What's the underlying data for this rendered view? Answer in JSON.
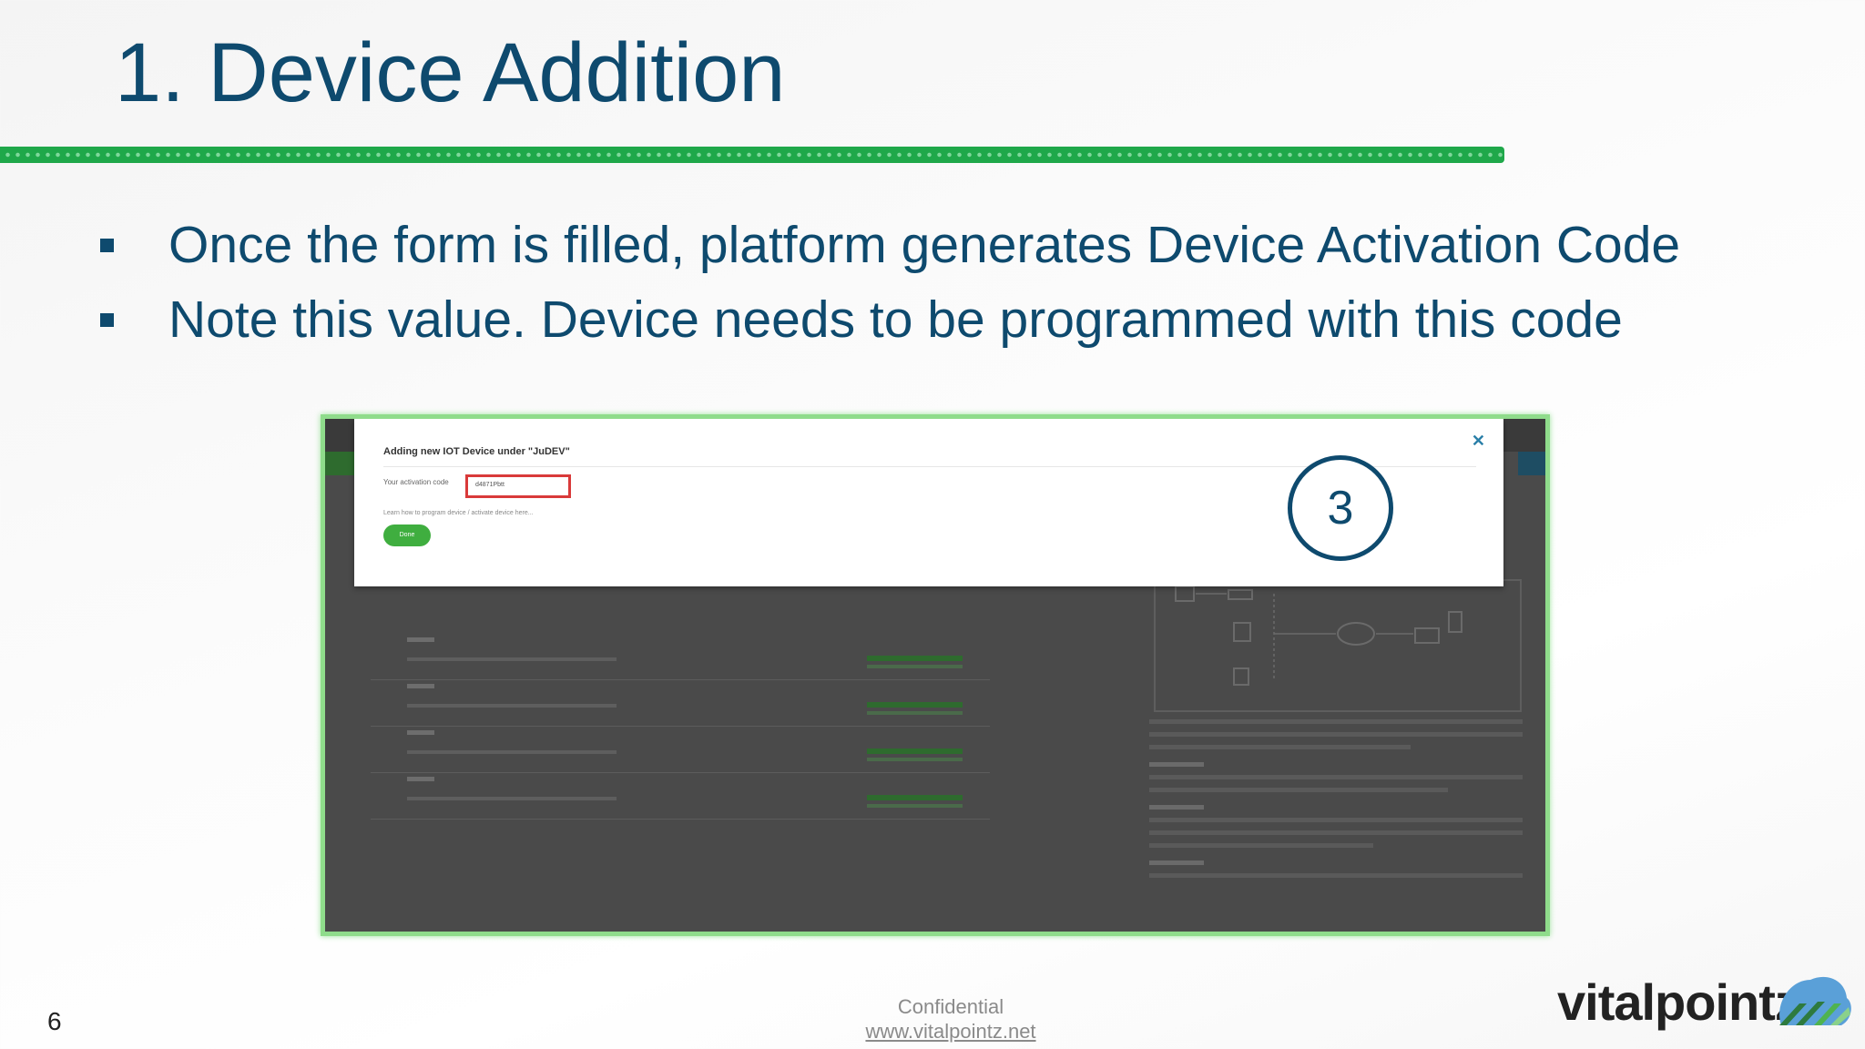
{
  "slide": {
    "title": "1. Device Addition",
    "bullets": [
      "Once the form is filled, platform generates Device Activation Code",
      "Note this value. Device needs to be programmed with this code"
    ]
  },
  "screenshot": {
    "modal": {
      "title": "Adding new IOT Device under \"JuDEV\"",
      "activation_label": "Your activation code",
      "activation_code": "d4871Pbtt",
      "help_link": "Learn how to program device / activate device here...",
      "done_label": "Done",
      "close_icon": "close-icon"
    },
    "step_number": "3"
  },
  "footer": {
    "page_number": "6",
    "confidential": "Confidential",
    "url": "www.vitalpointz.net",
    "brand": "vitalpointz"
  },
  "colors": {
    "title": "#0e4a6e",
    "rule": "#1fa84a",
    "frame": "#8fdc8b",
    "highlight": "#d93a3a",
    "done_button": "#3fae3f"
  }
}
